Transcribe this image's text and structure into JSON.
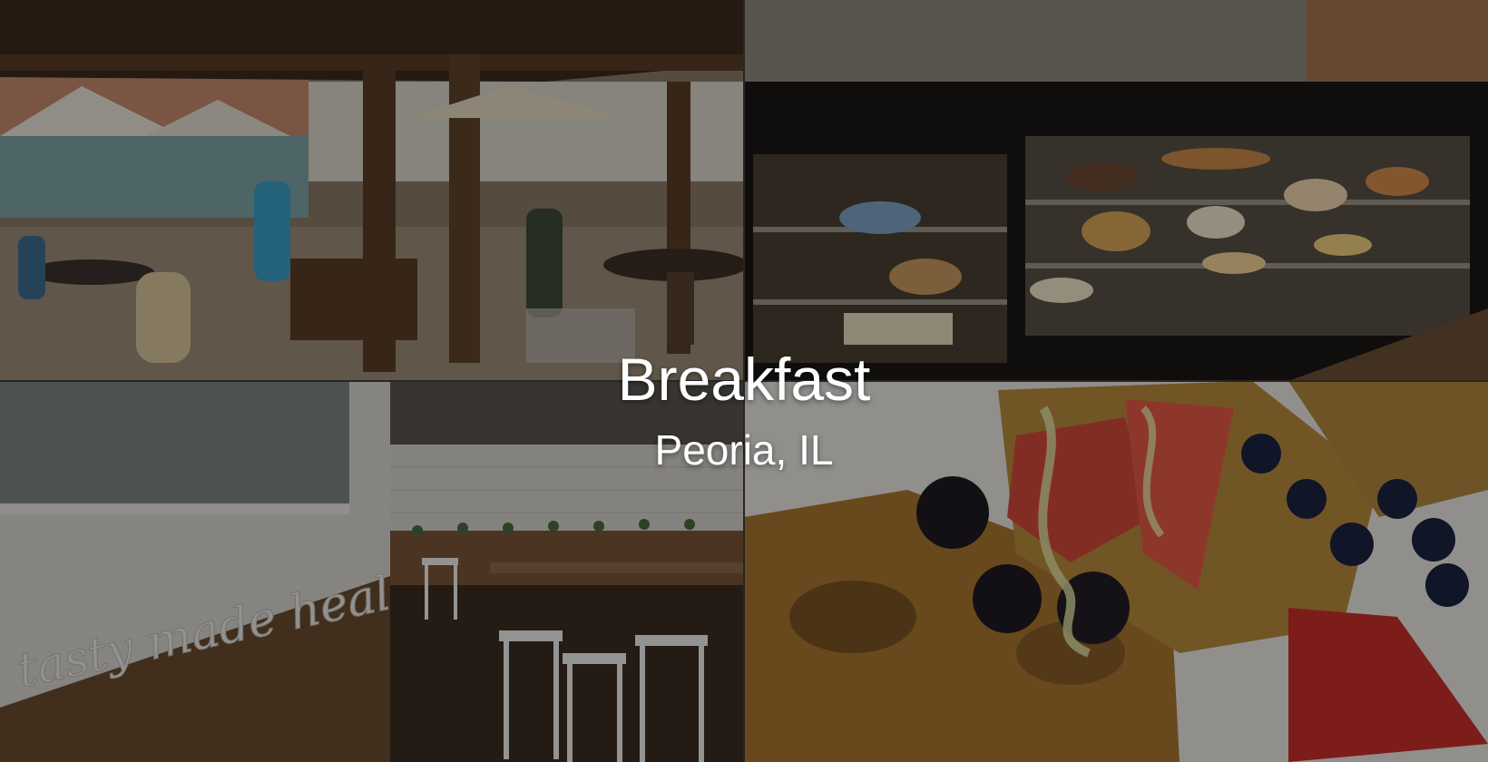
{
  "hero": {
    "title": "Breakfast",
    "subtitle": "Peoria, IL"
  },
  "collage": {
    "tiles": [
      {
        "subject": "outdoor-patio-photo"
      },
      {
        "subject": "bakery-display-case-photo"
      },
      {
        "subject": "interior-wall-sign-photo"
      },
      {
        "subject": "dining-room-photo"
      },
      {
        "subject": "french-toast-with-berries-photo"
      }
    ]
  },
  "wall_sign": {
    "script_text": "tasty made healthy"
  },
  "colors": {
    "overlay_text": "#ffffff",
    "dim_overlay": "rgba(0,0,0,0.38)"
  }
}
